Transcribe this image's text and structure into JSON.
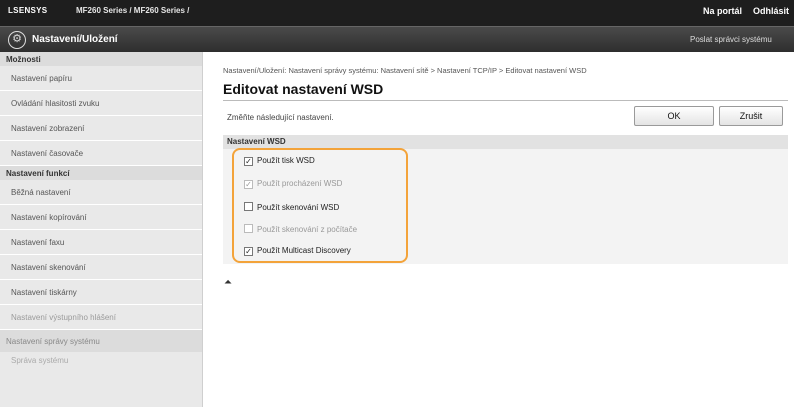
{
  "topbar": {
    "brand": "LSENSYS",
    "model": "MF260 Series / MF260 Series /",
    "portal_link": "Na portál",
    "logout_link": "Odhlásit"
  },
  "header": {
    "title": "Nastavení/Uložení",
    "mail_link": "Poslat správci systému"
  },
  "sidebar": {
    "options_heading": "Možnosti",
    "options": [
      {
        "label": "Nastavení papíru"
      },
      {
        "label": "Ovládání hlasitosti zvuku"
      },
      {
        "label": "Nastavení zobrazení"
      },
      {
        "label": "Nastavení časovače"
      }
    ],
    "functions_heading": "Nastavení funkcí",
    "functions": [
      {
        "label": "Běžná nastavení"
      },
      {
        "label": "Nastavení kopírování"
      },
      {
        "label": "Nastavení faxu"
      },
      {
        "label": "Nastavení skenování"
      },
      {
        "label": "Nastavení tiskárny"
      },
      {
        "label": "Nastavení výstupního hlášení"
      }
    ],
    "system_section": "Nastavení správy systému",
    "system_sub": "Správa systému"
  },
  "main": {
    "breadcrumb": "Nastavení/Uložení: Nastavení správy systému: Nastavení sítě > Nastavení TCP/IP > Editovat nastavení WSD",
    "title": "Editovat nastavení WSD",
    "instruction": "Změňte následující nastavení.",
    "ok_label": "OK",
    "cancel_label": "Zrušit",
    "group_title": "Nastavení WSD",
    "options": [
      {
        "label": "Použít tisk WSD",
        "checked": true,
        "disabled": false
      },
      {
        "label": "Použít procházení WSD",
        "checked": true,
        "disabled": true
      },
      {
        "label": "Použít skenování WSD",
        "checked": false,
        "disabled": false
      },
      {
        "label": "Použít skenování z počítače",
        "checked": false,
        "disabled": true
      },
      {
        "label": "Použít Multicast Discovery",
        "checked": true,
        "disabled": false
      }
    ],
    "to_top_icon": "to-top-icon",
    "to_top_glyph": "⏶"
  },
  "colors": {
    "highlight": "#f3a33a",
    "topbar": "#1e1e1e",
    "sidebar": "#e9e9e9"
  }
}
